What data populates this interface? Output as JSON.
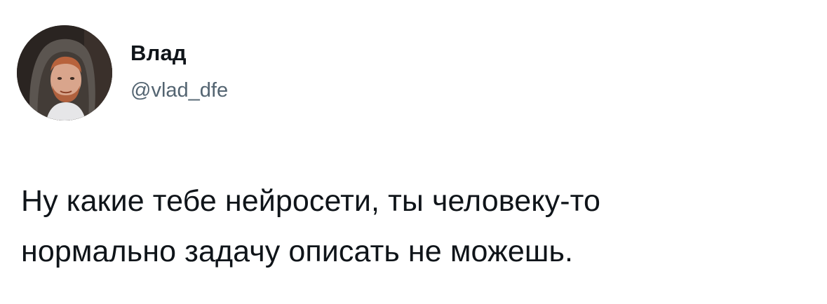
{
  "tweet": {
    "author": {
      "display_name": "Влад",
      "handle": "@vlad_dfe",
      "avatar_icon": "user-photo"
    },
    "body_lines": [
      "Ну какие тебе нейросети, ты человеку-то",
      "нормально задачу описать не можешь."
    ]
  },
  "colors": {
    "background": "#ffffff",
    "text_primary": "#0f1419",
    "text_secondary": "#536471"
  }
}
